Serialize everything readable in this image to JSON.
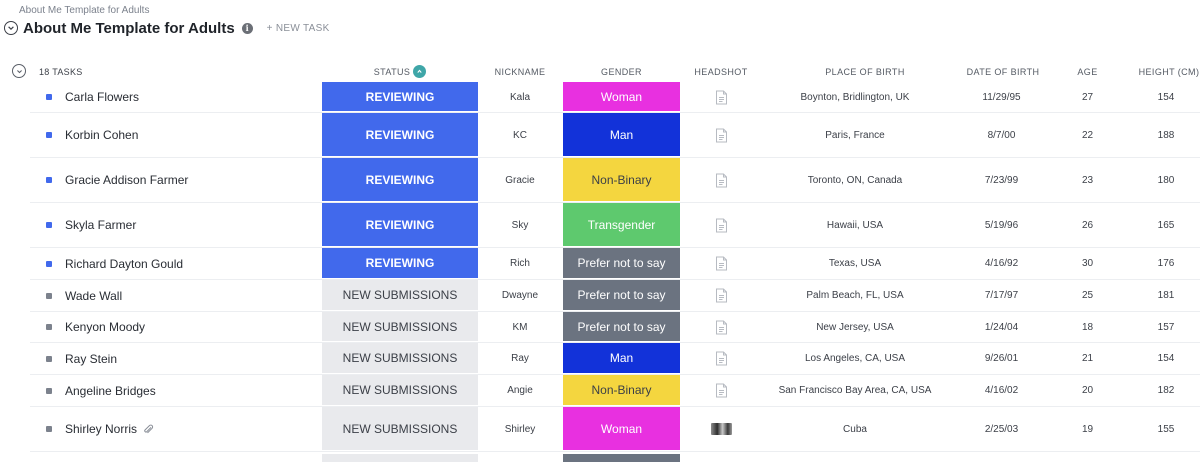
{
  "breadcrumb": "About Me Template for Adults",
  "title": "About Me Template for Adults",
  "new_task": "+ NEW TASK",
  "group": {
    "count_label": "18 TASKS"
  },
  "columns": {
    "status": "STATUS",
    "nickname": "NICKNAME",
    "gender": "GENDER",
    "headshot": "HEADSHOT",
    "place_of_birth": "PLACE OF BIRTH",
    "date_of_birth": "DATE OF BIRTH",
    "age": "AGE",
    "height": "HEIGHT (CM)"
  },
  "colors": {
    "reviewing": "#4169ec",
    "new_submissions": "#e9eaed",
    "woman": "#e830e0",
    "man": "#1232d9",
    "non_binary": "#f4d63f",
    "transgender": "#5ec96e",
    "prefer_not": "#6b7380",
    "sort_accent": "#3fa6a8"
  },
  "rows": [
    {
      "name": "Carla Flowers",
      "status": "REVIEWING",
      "nickname": "Kala",
      "gender": "Woman",
      "headshot": "file-icon",
      "place_of_birth": "Boynton, Bridlington, UK",
      "date_of_birth": "11/29/95",
      "age": "27",
      "height": "154"
    },
    {
      "name": "Korbin Cohen",
      "status": "REVIEWING",
      "nickname": "KC",
      "gender": "Man",
      "headshot": "file-icon",
      "place_of_birth": "Paris, France",
      "date_of_birth": "8/7/00",
      "age": "22",
      "height": "188"
    },
    {
      "name": "Gracie Addison Farmer",
      "status": "REVIEWING",
      "nickname": "Gracie",
      "gender": "Non-Binary",
      "headshot": "file-icon",
      "place_of_birth": "Toronto, ON, Canada",
      "date_of_birth": "7/23/99",
      "age": "23",
      "height": "180"
    },
    {
      "name": "Skyla Farmer",
      "status": "REVIEWING",
      "nickname": "Sky",
      "gender": "Transgender",
      "headshot": "file-icon",
      "place_of_birth": "Hawaii, USA",
      "date_of_birth": "5/19/96",
      "age": "26",
      "height": "165"
    },
    {
      "name": "Richard Dayton Gould",
      "status": "REVIEWING",
      "nickname": "Rich",
      "gender": "Prefer not to say",
      "headshot": "file-icon",
      "place_of_birth": "Texas, USA",
      "date_of_birth": "4/16/92",
      "age": "30",
      "height": "176"
    },
    {
      "name": "Wade Wall",
      "status": "NEW SUBMISSIONS",
      "nickname": "Dwayne",
      "gender": "Prefer not to say",
      "headshot": "file-icon",
      "place_of_birth": "Palm Beach, FL, USA",
      "date_of_birth": "7/17/97",
      "age": "25",
      "height": "181"
    },
    {
      "name": "Kenyon Moody",
      "status": "NEW SUBMISSIONS",
      "nickname": "KM",
      "gender": "Prefer not to say",
      "headshot": "file-icon",
      "place_of_birth": "New Jersey, USA",
      "date_of_birth": "1/24/04",
      "age": "18",
      "height": "157"
    },
    {
      "name": "Ray Stein",
      "status": "NEW SUBMISSIONS",
      "nickname": "Ray",
      "gender": "Man",
      "headshot": "file-icon",
      "place_of_birth": "Los Angeles, CA, USA",
      "date_of_birth": "9/26/01",
      "age": "21",
      "height": "154"
    },
    {
      "name": "Angeline Bridges",
      "status": "NEW SUBMISSIONS",
      "nickname": "Angie",
      "gender": "Non-Binary",
      "headshot": "file-icon",
      "place_of_birth": "San Francisco Bay Area, CA, USA",
      "date_of_birth": "4/16/02",
      "age": "20",
      "height": "182"
    },
    {
      "name": "Shirley Norris",
      "status": "NEW SUBMISSIONS",
      "nickname": "Shirley",
      "gender": "Woman",
      "headshot": "photo-thumbnail",
      "place_of_birth": "Cuba",
      "date_of_birth": "2/25/03",
      "age": "19",
      "height": "155",
      "attachment": true
    }
  ]
}
